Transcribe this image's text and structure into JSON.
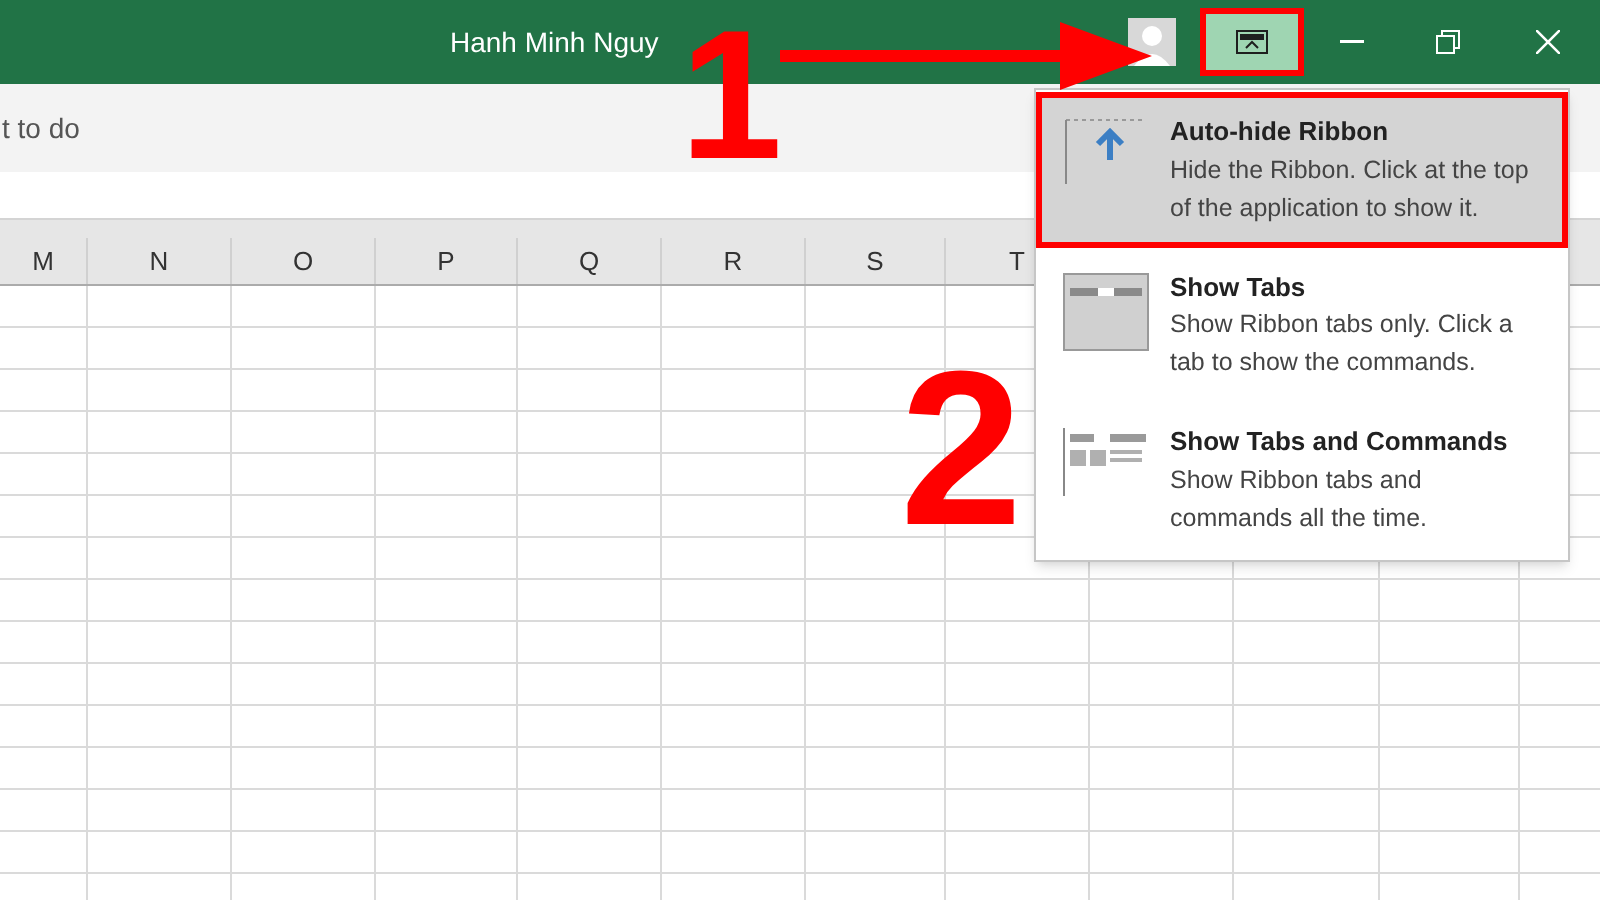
{
  "title_bar": {
    "user_name": "Hanh Minh Nguy",
    "ribbon_options_button": {
      "highlighted": true
    }
  },
  "tell_me": {
    "text": "t to do"
  },
  "sheet": {
    "columns": [
      "M",
      "N",
      "O",
      "P",
      "Q",
      "R",
      "S",
      "T"
    ]
  },
  "ribbon_menu": {
    "items": [
      {
        "kind": "autohide",
        "title": "Auto-hide Ribbon",
        "description": "Hide the Ribbon. Click at the top of the application to show it.",
        "selected": true
      },
      {
        "kind": "tabs",
        "title": "Show Tabs",
        "description": "Show Ribbon tabs only. Click a tab to show the commands.",
        "selected": false
      },
      {
        "kind": "commands",
        "title": "Show Tabs and Commands",
        "description": "Show Ribbon tabs and commands all the time.",
        "selected": false
      }
    ]
  },
  "annotations": [
    {
      "label": "1"
    },
    {
      "label": "2"
    }
  ]
}
